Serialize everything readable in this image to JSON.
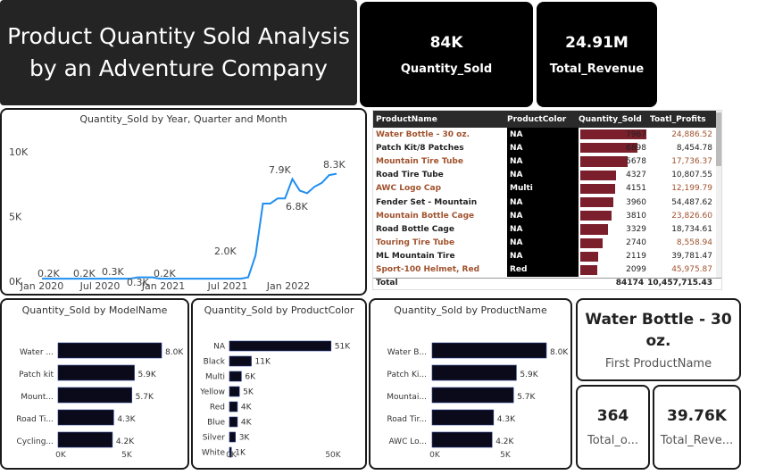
{
  "header": {
    "title_line1": "Product Quantity Sold Analysis",
    "title_line2": "by an Adventure Company"
  },
  "kpis": {
    "quantity": {
      "value": "84K",
      "label": "Quantity_Sold"
    },
    "revenue": {
      "value": "24.91M",
      "label": "Total_Revenue"
    }
  },
  "line_panel": {
    "title": "Quantity_Sold by Year, Quarter and Month"
  },
  "table": {
    "headers": [
      "ProductName",
      "ProductColor",
      "Quantity_Sold",
      "Toatl_Profits"
    ],
    "rows": [
      {
        "name": "Water Bottle - 30 oz.",
        "color": "NA",
        "qty": "7967",
        "profit": "24,886.52",
        "highlight": true
      },
      {
        "name": "Patch Kit/8 Patches",
        "color": "NA",
        "qty": "6898",
        "profit": "8,454.78",
        "highlight": false
      },
      {
        "name": "Mountain Tire Tube",
        "color": "NA",
        "qty": "5678",
        "profit": "17,736.37",
        "highlight": true
      },
      {
        "name": "Road Tire Tube",
        "color": "NA",
        "qty": "4327",
        "profit": "10,807.55",
        "highlight": false
      },
      {
        "name": "AWC Logo Cap",
        "color": "Multi",
        "qty": "4151",
        "profit": "12,199.79",
        "highlight": true
      },
      {
        "name": "Fender Set - Mountain",
        "color": "NA",
        "qty": "3960",
        "profit": "54,487.62",
        "highlight": false
      },
      {
        "name": "Mountain Bottle Cage",
        "color": "NA",
        "qty": "3810",
        "profit": "23,826.60",
        "highlight": true
      },
      {
        "name": "Road Bottle Cage",
        "color": "NA",
        "qty": "3329",
        "profit": "18,734.61",
        "highlight": false
      },
      {
        "name": "Touring Tire Tube",
        "color": "NA",
        "qty": "2740",
        "profit": "8,558.94",
        "highlight": true
      },
      {
        "name": "ML Mountain Tire",
        "color": "NA",
        "qty": "2119",
        "profit": "39,781.47",
        "highlight": false
      },
      {
        "name": "Sport-100 Helmet, Red",
        "color": "Red",
        "qty": "2099",
        "profit": "45,975.87",
        "highlight": true
      }
    ],
    "total": {
      "label": "Total",
      "qty": "84174",
      "profit": "10,457,715.43"
    }
  },
  "model_panel": {
    "title": "Quantity_Sold by ModelName"
  },
  "color_panel": {
    "title": "Quantity_Sold by ProductColor"
  },
  "product_panel": {
    "title": "Quantity_Sold by ProductName"
  },
  "cards": {
    "first_product": {
      "value": "Water Bottle - 30 oz.",
      "label": "First ProductName"
    },
    "total_o": {
      "value": "364",
      "label": "Total_o..."
    },
    "total_reve": {
      "value": "39.76K",
      "label": "Total_Reve..."
    }
  },
  "colors": {
    "accent_line": "#1f8ef1",
    "bar_dark": "#0a0a1a",
    "bar_table": "#7a1f2b",
    "table_header": "#2a2a2a",
    "row_highlight": "#a0522d"
  },
  "chart_data": [
    {
      "type": "line",
      "title": "Quantity_Sold by Year, Quarter and Month",
      "x_ticks": [
        "Jan 2020",
        "Jul 2020",
        "Jan 2021",
        "Jul 2021",
        "Jan 2022"
      ],
      "y_ticks": [
        "0K",
        "5K",
        "10K"
      ],
      "ylim": [
        0,
        10000
      ],
      "series": [
        {
          "values": [
            200,
            200,
            200,
            200,
            200,
            200,
            200,
            200,
            200,
            200,
            200,
            200,
            200,
            300,
            300,
            300,
            200,
            200,
            200,
            200,
            200,
            200,
            200,
            200,
            200,
            200,
            200,
            200,
            300,
            2000,
            6000,
            6000,
            6400,
            6400,
            7900,
            7000,
            6800,
            7300,
            7600,
            8200,
            8300
          ]
        }
      ],
      "data_labels": [
        "0.2K",
        "0.2K",
        "0.3K",
        "0.3K",
        "0.2K",
        "2.0K",
        "7.9K",
        "6.8K",
        "8.3K"
      ]
    },
    {
      "type": "bar",
      "title": "Quantity_Sold by ModelName",
      "categories": [
        "Water ...",
        "Patch kit",
        "Mount...",
        "Road Ti...",
        "Cycling..."
      ],
      "values": [
        8000,
        5900,
        5700,
        4300,
        4200
      ],
      "data_labels": [
        "8.0K",
        "5.9K",
        "5.7K",
        "4.3K",
        "4.2K"
      ],
      "x_ticks": [
        "0K",
        "5K"
      ],
      "xlim": [
        0,
        8000
      ]
    },
    {
      "type": "bar",
      "title": "Quantity_Sold by ProductColor",
      "categories": [
        "NA",
        "Black",
        "Multi",
        "Yellow",
        "Red",
        "Blue",
        "Silver",
        "White"
      ],
      "values": [
        51000,
        11000,
        6000,
        5000,
        4000,
        4000,
        3000,
        1000
      ],
      "data_labels": [
        "51K",
        "11K",
        "6K",
        "5K",
        "4K",
        "4K",
        "3K",
        "1K"
      ],
      "x_ticks": [
        "0K",
        "50K"
      ],
      "xlim": [
        0,
        52000
      ]
    },
    {
      "type": "bar",
      "title": "Quantity_Sold by ProductName",
      "categories": [
        "Water B...",
        "Patch Ki...",
        "Mountai...",
        "Road Tir...",
        "AWC Lo..."
      ],
      "values": [
        8000,
        5900,
        5700,
        4300,
        4200
      ],
      "data_labels": [
        "8.0K",
        "5.9K",
        "5.7K",
        "4.3K",
        "4.2K"
      ],
      "x_ticks": [
        "0K",
        "5K"
      ],
      "xlim": [
        0,
        8000
      ]
    }
  ]
}
